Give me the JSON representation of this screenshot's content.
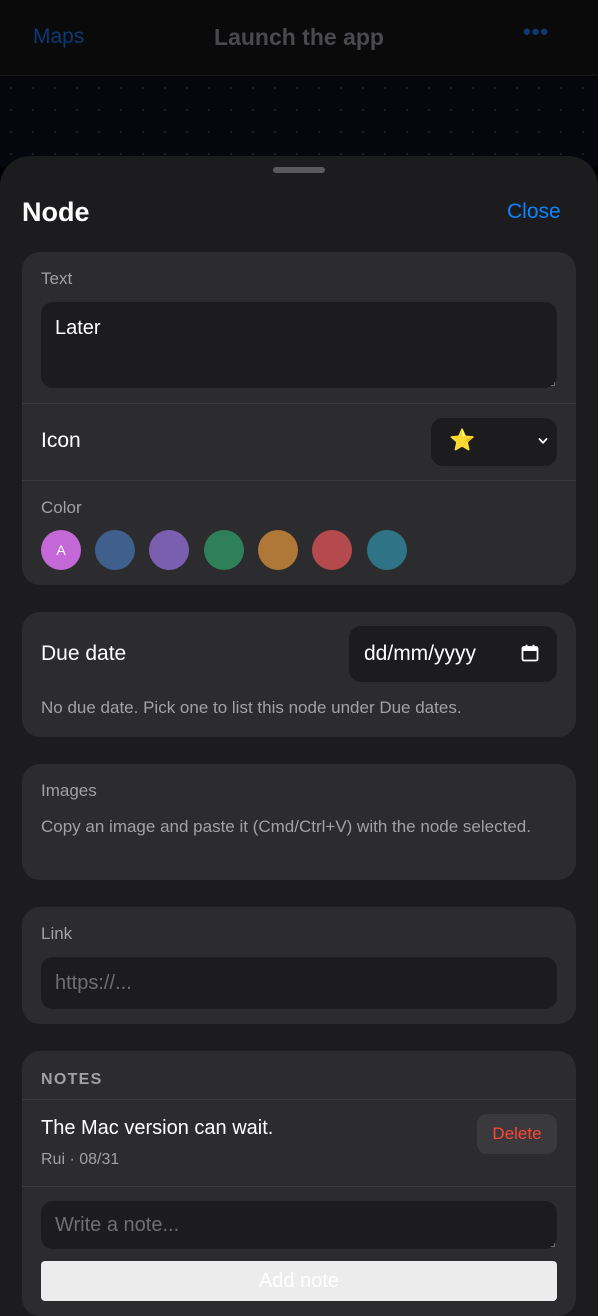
{
  "topbar": {
    "back_label": "Maps",
    "title": "Launch the app",
    "more_label": "•••"
  },
  "sheet": {
    "title": "Node",
    "close_label": "Close"
  },
  "text_section": {
    "label": "Text",
    "value": "Later"
  },
  "icon_section": {
    "label": "Icon",
    "selected": "⭐"
  },
  "color_section": {
    "label": "Color",
    "selected_mark": "A",
    "swatches": [
      "#c468d8",
      "#3f5f8c",
      "#7a5fb0",
      "#2f7f5a",
      "#b07838",
      "#b54a4e",
      "#2f7386"
    ]
  },
  "due_section": {
    "label": "Due date",
    "placeholder": "dd/mm/yyyy",
    "helper": "No due date. Pick one to list this node under Due dates."
  },
  "images_section": {
    "label": "Images",
    "helper": "Copy an image and paste it (Cmd/Ctrl+V) with the node selected."
  },
  "link_section": {
    "label": "Link",
    "placeholder": "https://..."
  },
  "notes_section": {
    "header": "NOTES",
    "notes": [
      {
        "text": "The Mac version can wait.",
        "meta": "Rui · 08/31",
        "delete_label": "Delete"
      }
    ],
    "input_placeholder": "Write a note...",
    "add_label": "Add note"
  },
  "colors": {
    "accent": "#0a84ff",
    "danger": "#ff453a",
    "card": "#2c2c2e",
    "sheet": "#1c1c1e"
  }
}
